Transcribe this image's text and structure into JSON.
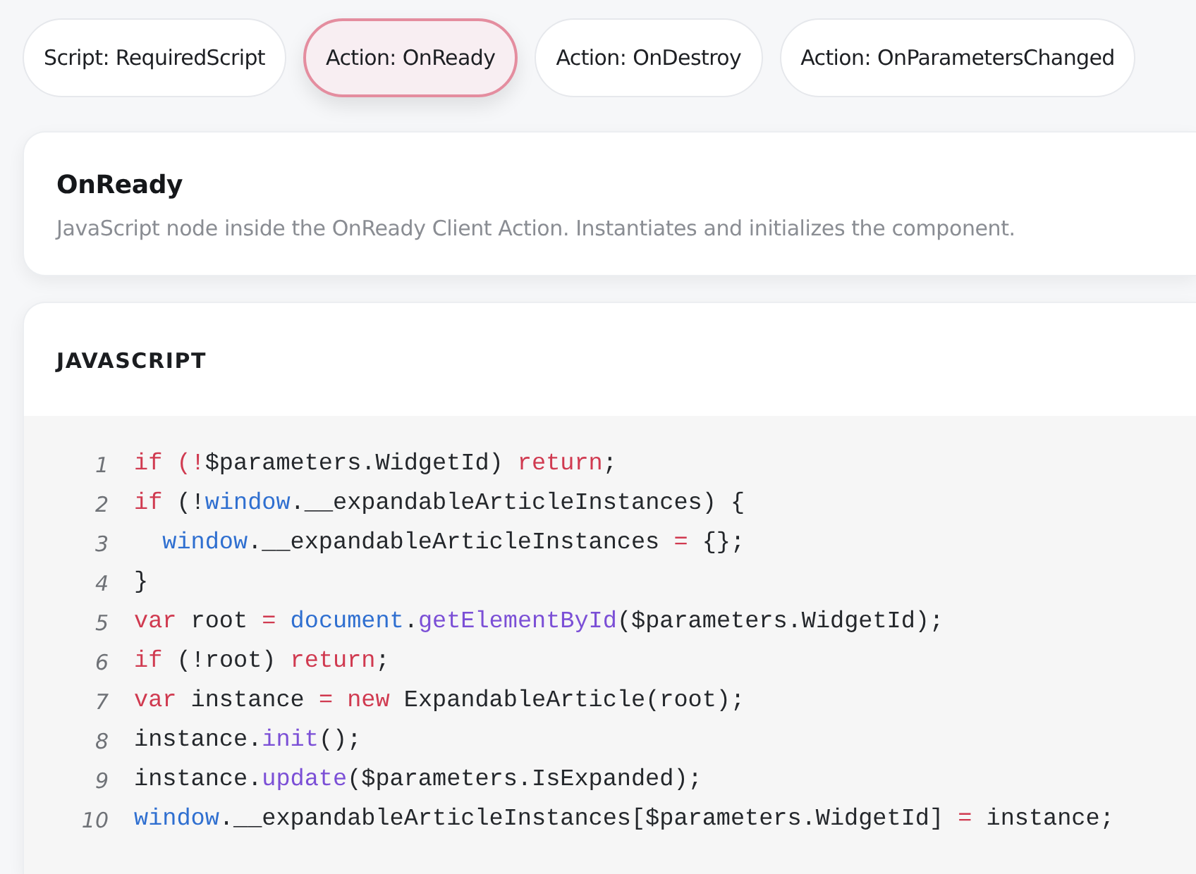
{
  "tabs": [
    {
      "label": "Script: RequiredScript",
      "selected": false
    },
    {
      "label": "Action: OnReady",
      "selected": true
    },
    {
      "label": "Action: OnDestroy",
      "selected": false
    },
    {
      "label": "Action: OnParametersChanged",
      "selected": false
    }
  ],
  "detail": {
    "title": "OnReady",
    "description": "JavaScript node inside the OnReady Client Action. Instantiates and initializes the component."
  },
  "code_panel": {
    "language": "JAVASCRIPT",
    "lines": [
      {
        "number": "1",
        "tokens": [
          {
            "kind": "keyword",
            "text": "if (!"
          },
          {
            "kind": "plain",
            "text": "$parameters.WidgetId) "
          },
          {
            "kind": "keyword",
            "text": "return"
          },
          {
            "kind": "plain",
            "text": ";"
          }
        ]
      },
      {
        "number": "2",
        "tokens": [
          {
            "kind": "keyword",
            "text": "if"
          },
          {
            "kind": "plain",
            "text": " (!"
          },
          {
            "kind": "builtin",
            "text": "window"
          },
          {
            "kind": "plain",
            "text": ".__expandableArticleInstances) {"
          }
        ]
      },
      {
        "number": "3",
        "tokens": [
          {
            "kind": "builtin",
            "text": "  window"
          },
          {
            "kind": "plain",
            "text": ".__expandableArticleInstances "
          },
          {
            "kind": "operator",
            "text": "="
          },
          {
            "kind": "plain",
            "text": " {};"
          }
        ]
      },
      {
        "number": "4",
        "tokens": [
          {
            "kind": "plain",
            "text": "}"
          }
        ]
      },
      {
        "number": "5",
        "tokens": [
          {
            "kind": "keyword",
            "text": "var"
          },
          {
            "kind": "plain",
            "text": " root "
          },
          {
            "kind": "operator",
            "text": "="
          },
          {
            "kind": "builtin",
            "text": " document"
          },
          {
            "kind": "plain",
            "text": "."
          },
          {
            "kind": "method",
            "text": "getElementById"
          },
          {
            "kind": "plain",
            "text": "($parameters.WidgetId);"
          }
        ]
      },
      {
        "number": "6",
        "tokens": [
          {
            "kind": "keyword",
            "text": "if"
          },
          {
            "kind": "plain",
            "text": " (!root) "
          },
          {
            "kind": "keyword",
            "text": "return"
          },
          {
            "kind": "plain",
            "text": ";"
          }
        ]
      },
      {
        "number": "7",
        "tokens": [
          {
            "kind": "keyword",
            "text": "var"
          },
          {
            "kind": "plain",
            "text": " instance "
          },
          {
            "kind": "operator",
            "text": "="
          },
          {
            "kind": "keyword",
            "text": " new"
          },
          {
            "kind": "plain",
            "text": " ExpandableArticle(root);"
          }
        ]
      },
      {
        "number": "8",
        "tokens": [
          {
            "kind": "plain",
            "text": "instance."
          },
          {
            "kind": "method",
            "text": "init"
          },
          {
            "kind": "plain",
            "text": "();"
          }
        ]
      },
      {
        "number": "9",
        "tokens": [
          {
            "kind": "plain",
            "text": "instance."
          },
          {
            "kind": "method",
            "text": "update"
          },
          {
            "kind": "plain",
            "text": "($parameters.IsExpanded);"
          }
        ]
      },
      {
        "number": "10",
        "tokens": [
          {
            "kind": "builtin",
            "text": "window"
          },
          {
            "kind": "plain",
            "text": ".__expandableArticleInstances[$parameters.WidgetId] "
          },
          {
            "kind": "operator",
            "text": "="
          },
          {
            "kind": "plain",
            "text": " instance;"
          }
        ]
      }
    ]
  }
}
